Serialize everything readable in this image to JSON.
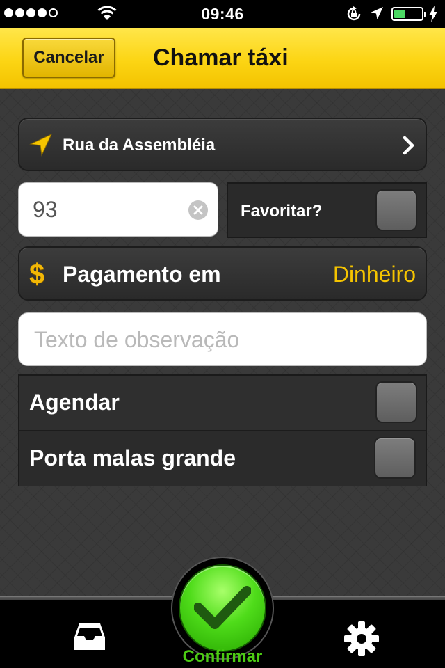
{
  "status_bar": {
    "time": "09:46",
    "signal_dots_filled": 4,
    "signal_dots_total": 5,
    "battery_level": 0.38,
    "icons": [
      "wifi-icon",
      "rotation-lock-icon",
      "location-arrow-icon",
      "battery-icon",
      "charging-bolt-icon"
    ]
  },
  "header": {
    "cancel_label": "Cancelar",
    "title": "Chamar táxi"
  },
  "address": {
    "label": "Rua da Assembléia",
    "icon": "navigation-arrow-icon"
  },
  "number_field": {
    "value": "93"
  },
  "favorite": {
    "label": "Favoritar?",
    "checked": false
  },
  "payment": {
    "label": "Pagamento em",
    "value": "Dinheiro",
    "icon": "dollar-icon"
  },
  "observation_field": {
    "placeholder": "Texto de observação",
    "value": ""
  },
  "options": [
    {
      "label": "Agendar",
      "checked": false
    },
    {
      "label": "Porta malas grande",
      "checked": false
    }
  ],
  "tab_bar": {
    "confirm_label": "Confirmar",
    "icons": [
      "inbox-icon",
      "confirm-check-icon",
      "gear-icon"
    ]
  },
  "colors": {
    "header_yellow": "#fcd514",
    "payment_value": "#f5c400",
    "confirm_green": "#4ccb13",
    "background": "#3a3a3a"
  }
}
